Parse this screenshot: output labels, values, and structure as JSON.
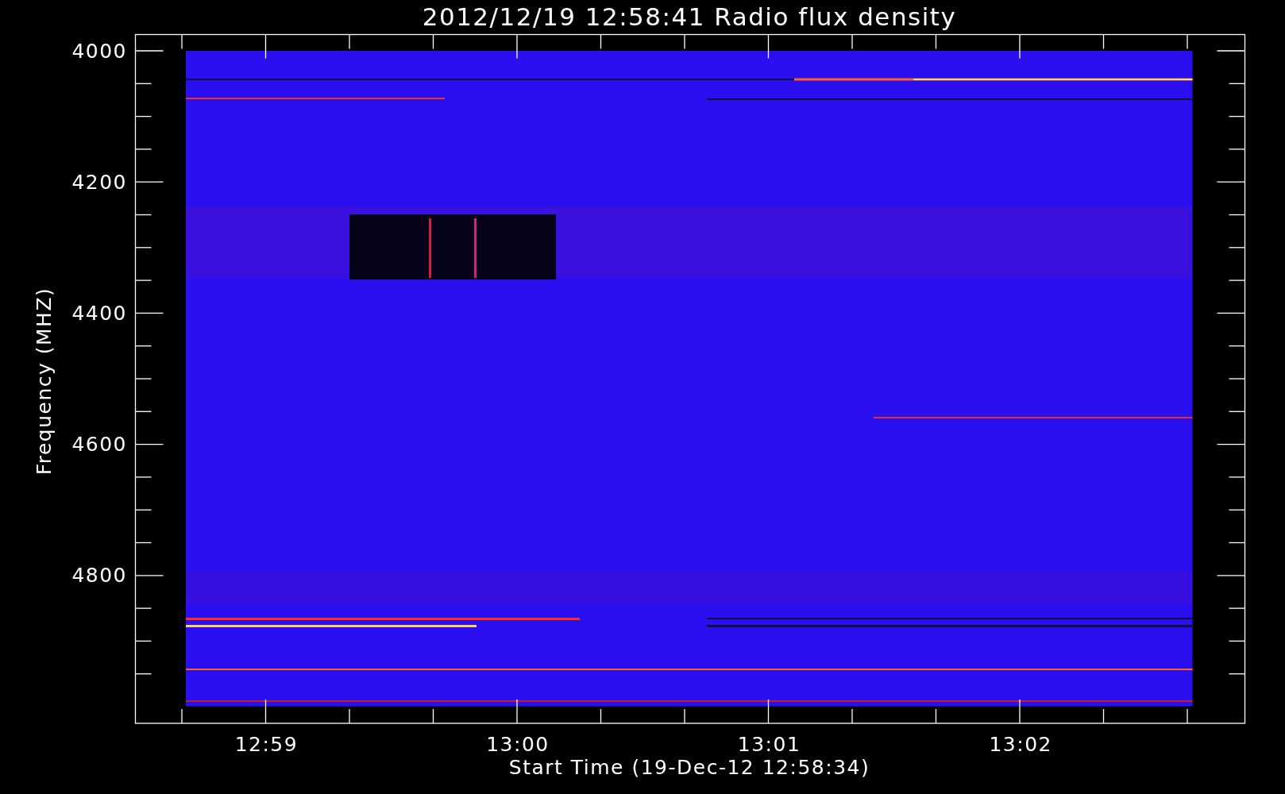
{
  "title": "2012/12/19 12:58:41 Radio flux density",
  "y_axis": {
    "label": "Frequency (MHZ)",
    "ticks": [
      "4000",
      "4200",
      "4400",
      "4600",
      "4800"
    ]
  },
  "x_axis": {
    "label": "Start Time (19-Dec-12 12:58:34)",
    "ticks": [
      "12:59",
      "13:00",
      "13:01",
      "13:02"
    ]
  }
}
